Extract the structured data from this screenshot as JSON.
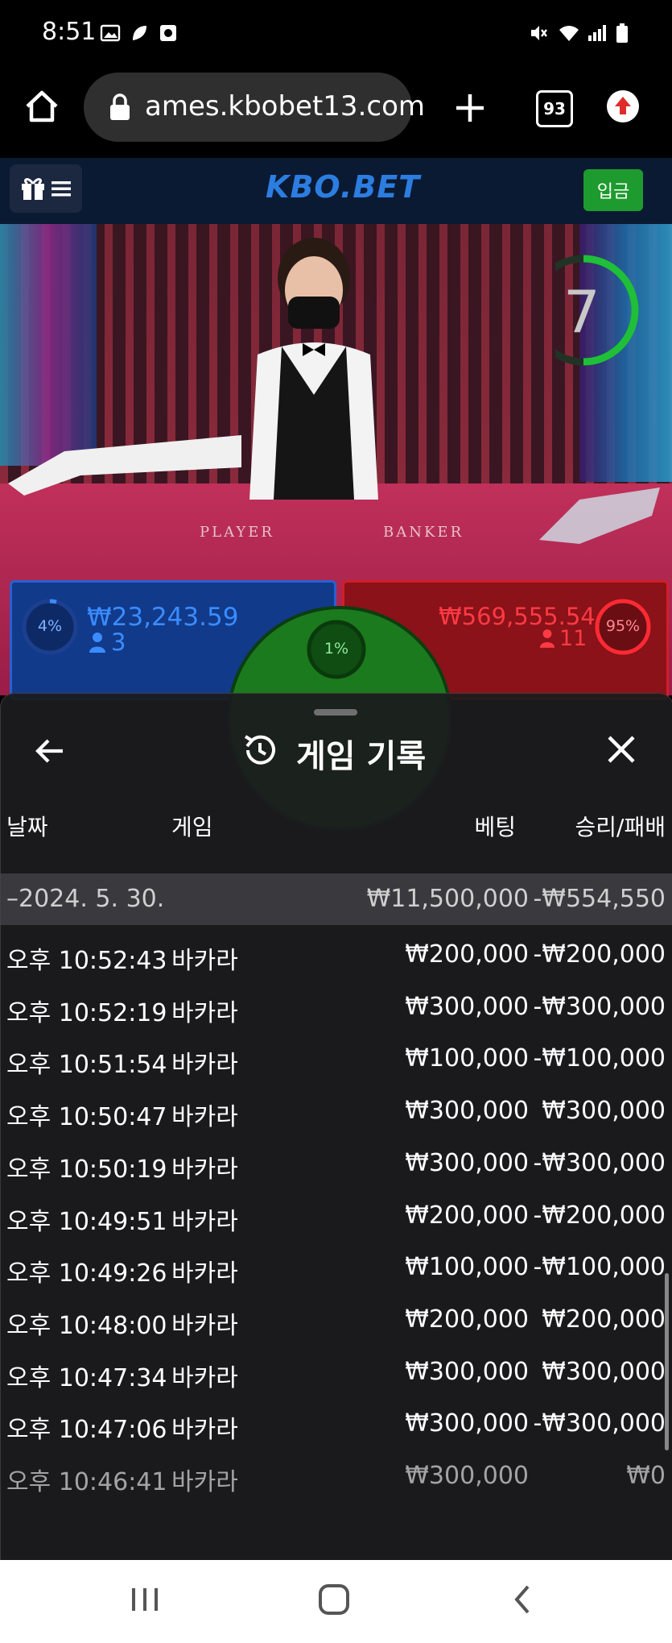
{
  "status_bar": {
    "time": "8:51",
    "left_icons": [
      "image-icon",
      "leaf-icon",
      "screen-record-icon"
    ],
    "right_icons": [
      "mute-icon",
      "wifi-icon",
      "signal-icon",
      "battery-icon"
    ]
  },
  "browser": {
    "url": "ames.kbobet13.com",
    "tab_count": "93"
  },
  "site": {
    "logo": "KBO.BET",
    "deposit_label": "입금"
  },
  "game": {
    "timer": "7",
    "table_player_label": "PLAYER",
    "table_banker_label": "BANKER",
    "player": {
      "percent": "4%",
      "amount": "₩23,243.59",
      "players": "3"
    },
    "banker": {
      "percent": "95%",
      "amount": "₩569,555.54",
      "players": "11"
    },
    "tie": {
      "percent": "1%"
    }
  },
  "history": {
    "title": "게임 기록",
    "columns": {
      "date": "날짜",
      "game": "게임",
      "bet": "베팅",
      "result": "승리/패배"
    },
    "summary": {
      "date": "–2024. 5. 30.",
      "bet": "₩11,500,000",
      "result": "-₩554,550"
    },
    "rows": [
      {
        "time": "오후 10:52:43",
        "game": "바카라",
        "bet": "₩200,000",
        "result": "-₩200,000"
      },
      {
        "time": "오후 10:52:19",
        "game": "바카라",
        "bet": "₩300,000",
        "result": "-₩300,000"
      },
      {
        "time": "오후 10:51:54",
        "game": "바카라",
        "bet": "₩100,000",
        "result": "-₩100,000"
      },
      {
        "time": "오후 10:50:47",
        "game": "바카라",
        "bet": "₩300,000",
        "result": "₩300,000"
      },
      {
        "time": "오후 10:50:19",
        "game": "바카라",
        "bet": "₩300,000",
        "result": "-₩300,000"
      },
      {
        "time": "오후 10:49:51",
        "game": "바카라",
        "bet": "₩200,000",
        "result": "-₩200,000"
      },
      {
        "time": "오후 10:49:26",
        "game": "바카라",
        "bet": "₩100,000",
        "result": "-₩100,000"
      },
      {
        "time": "오후 10:48:00",
        "game": "바카라",
        "bet": "₩200,000",
        "result": "₩200,000"
      },
      {
        "time": "오후 10:47:34",
        "game": "바카라",
        "bet": "₩300,000",
        "result": "₩300,000"
      },
      {
        "time": "오후 10:47:06",
        "game": "바카라",
        "bet": "₩300,000",
        "result": "-₩300,000"
      },
      {
        "time": "오후 10:46:41",
        "game": "바카라",
        "bet": "₩300,000",
        "result": "₩0"
      }
    ]
  },
  "colors": {
    "player_blue": "#2b7be0",
    "banker_red": "#e0232d",
    "tie_green": "#1b7a1e",
    "deposit_green": "#1e9b2e"
  }
}
